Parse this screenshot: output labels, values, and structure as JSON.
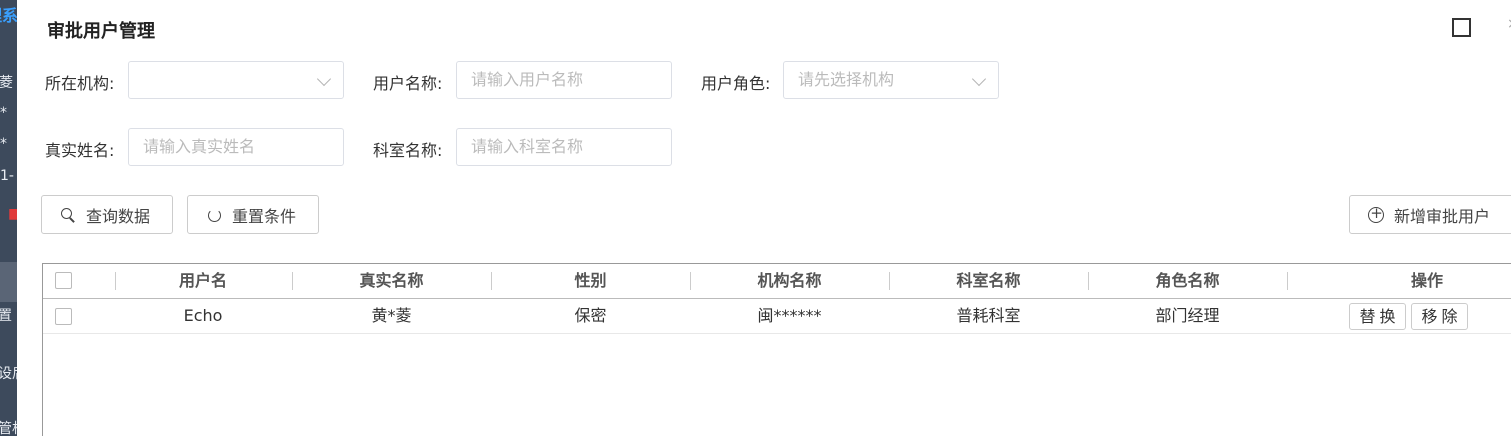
{
  "background": {
    "fragments": [
      "理系",
      "*菱",
      "*",
      "*",
      "1-",
      "置",
      "设后",
      "管机"
    ]
  },
  "modal": {
    "title": "审批用户管理",
    "maximize_label": "",
    "close_label": "×"
  },
  "form": {
    "org_label": "所在机构:",
    "org_value": "",
    "username_label": "用户名称:",
    "username_placeholder": "请输入用户名称",
    "role_label": "用户角色:",
    "role_placeholder": "请先选择机构",
    "realname_label": "真实姓名:",
    "realname_placeholder": "请输入真实姓名",
    "dept_label": "科室名称:",
    "dept_placeholder": "请输入科室名称"
  },
  "actions": {
    "query_label": "查询数据",
    "reset_label": "重置条件",
    "add_label": "新增审批用户"
  },
  "table": {
    "headers": [
      "用户名",
      "真实名称",
      "性别",
      "机构名称",
      "科室名称",
      "角色名称",
      "操作"
    ],
    "rows": [
      {
        "username": "Echo",
        "realname": "黄*菱",
        "gender": "保密",
        "org": "闽******",
        "dept": "普耗科室",
        "role": "部门经理",
        "replace_label": "替换",
        "remove_label": "移除"
      }
    ]
  }
}
